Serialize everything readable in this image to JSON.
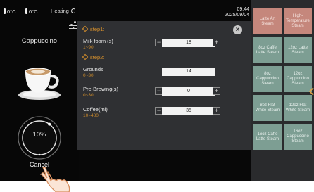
{
  "status_bar": {
    "temp_1": "0°C",
    "temp_2": "0°C",
    "heating_label": "Heating",
    "time": "09:44",
    "date": "2025/09/04"
  },
  "product": {
    "name": "Cappuccino"
  },
  "progress": {
    "text": "10%",
    "value_percent": 10
  },
  "cancel_label": "Cancel",
  "dialog": {
    "step1_title": "step1:",
    "step2_title": "step2:",
    "params": [
      {
        "label": "Milk foam (s)",
        "range": "1~90",
        "value": "18",
        "stepper": true
      },
      {
        "label": "Grounds",
        "range": "0~30",
        "value": "14",
        "stepper": false
      },
      {
        "label": "Pre-Brewing(s)",
        "range": "0~30",
        "value": "0",
        "stepper": true
      },
      {
        "label": "Coffee(ml)",
        "range": "10~480",
        "value": "35",
        "stepper": true
      }
    ],
    "minus_glyph": "−",
    "plus_glyph": "+",
    "close_glyph": "×"
  },
  "recipes": [
    {
      "label": "Latte Art Steam",
      "color": "#c5877c"
    },
    {
      "label": "High-Temperature Steam",
      "color": "#c5877c"
    },
    {
      "label": "8oz Caffe Latte Steam",
      "color": "#7d9e93"
    },
    {
      "label": "12oz Latte Steam",
      "color": "#7d9e93"
    },
    {
      "label": "8oz Cappuccino Steam",
      "color": "#7d9e93"
    },
    {
      "label": "12oz Cappuccino Steam",
      "color": "#7d9e93"
    },
    {
      "label": "8oz Flat White Steam",
      "color": "#7d9e93"
    },
    {
      "label": "12oz Flat White Steam",
      "color": "#7d9e93"
    },
    {
      "label": "16oz Caffe Latte Steam",
      "color": "#7d9e93"
    },
    {
      "label": "16oz Cappuccino Steam",
      "color": "#7d9e93"
    }
  ],
  "colors": {
    "accent": "#d6902d",
    "dialog_bg": "#2f3033",
    "recipe_green": "#7d9e93",
    "recipe_salmon": "#c5877c"
  },
  "icons": [
    "thermometer-icon",
    "refresh-icon",
    "settings-sliders-icon",
    "close-icon",
    "coffee-cup-icon",
    "hand-pointer-icon",
    "chevron-left-icon"
  ]
}
